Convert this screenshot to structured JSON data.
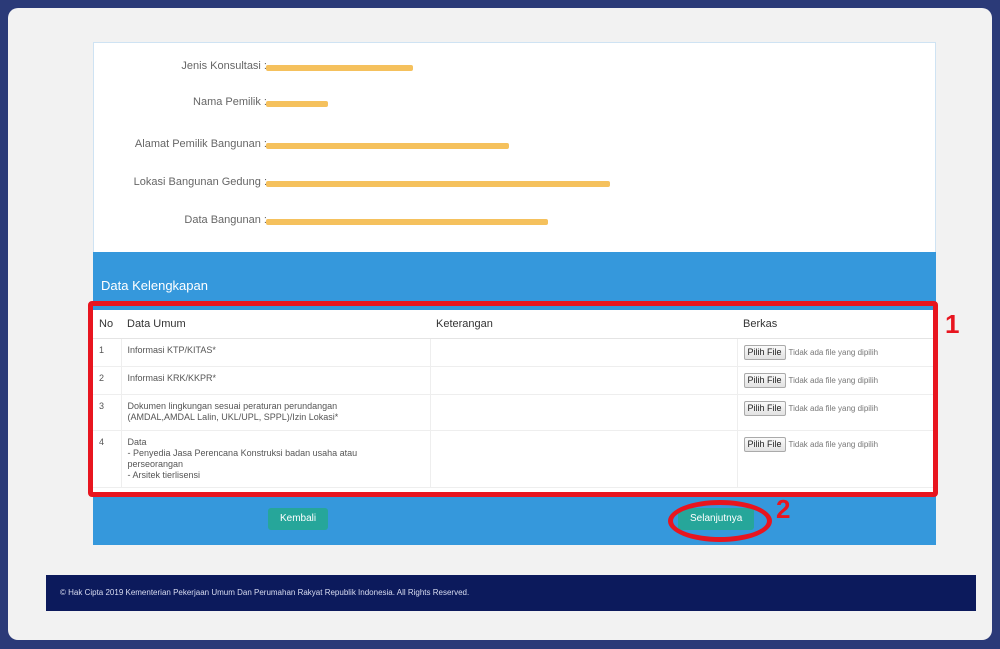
{
  "info": {
    "rows": [
      {
        "label": "Jenis Konsultasi :"
      },
      {
        "label": "Nama Pemilik :"
      },
      {
        "label": "Alamat Pemilik Bangunan :"
      },
      {
        "label": "Lokasi Bangunan Gedung :"
      },
      {
        "label": "Data Bangunan :"
      }
    ]
  },
  "section": {
    "title": "Data Kelengkapan"
  },
  "table": {
    "headers": {
      "no": "No",
      "data_umum": "Data Umum",
      "keterangan": "Keterangan",
      "berkas": "Berkas"
    },
    "rows": [
      {
        "no": "1",
        "data_umum": "Informasi KTP/KITAS*",
        "keterangan": "",
        "file_button": "Pilih File",
        "file_status": "Tidak ada file yang dipilih"
      },
      {
        "no": "2",
        "data_umum": "Informasi KRK/KKPR*",
        "keterangan": "",
        "file_button": "Pilih File",
        "file_status": "Tidak ada file yang dipilih"
      },
      {
        "no": "3",
        "data_umum": "Dokumen lingkungan sesuai peraturan perundangan\n(AMDAL,AMDAL Lalin, UKL/UPL, SPPL)/Izin Lokasi*",
        "keterangan": "",
        "file_button": "Pilih File",
        "file_status": "Tidak ada file yang dipilih"
      },
      {
        "no": "4",
        "data_umum": "Data\n- Penyedia Jasa Perencana Konstruksi badan usaha atau\nperseorangan\n- Arsitek tierlisensi",
        "keterangan": "",
        "file_button": "Pilih File",
        "file_status": "Tidak ada file yang dipilih"
      }
    ]
  },
  "buttons": {
    "back": "Kembali",
    "next": "Selanjutnya"
  },
  "footer": {
    "text": "© Hak Cipta 2019 Kementerian Pekerjaan Umum Dan Perumahan Rakyat Republik Indonesia. All Rights Reserved."
  },
  "annotations": {
    "marker1": "1",
    "marker2": "2",
    "color": "#e8151f"
  }
}
